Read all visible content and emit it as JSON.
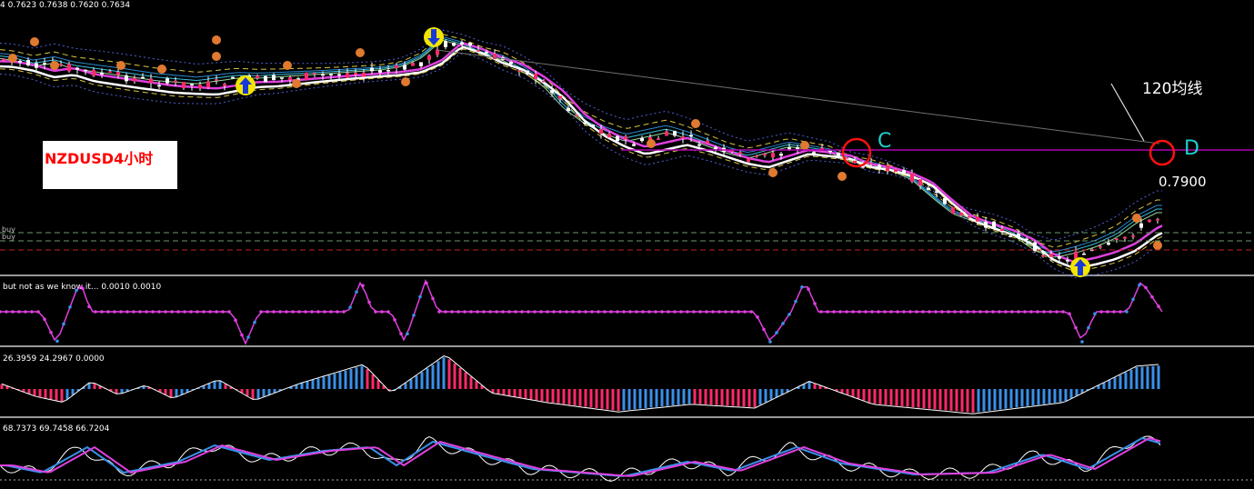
{
  "chart_data": [
    {
      "type": "candlestick",
      "panel": "price",
      "header_text": "4  0.7623 0.7638 0.7620 0.7634",
      "instrument_label": "NZDUSD4小时",
      "annotations": {
        "point_c": "C",
        "point_d": "D",
        "ma_label": "120均线",
        "price_level": "0.7900"
      },
      "buy_labels": [
        "buy",
        "buy"
      ],
      "trend_close": [
        0.795,
        0.7948,
        0.7944,
        0.7946,
        0.7942,
        0.794,
        0.7938,
        0.7936,
        0.7934,
        0.7933,
        0.7932,
        0.7934,
        0.7936,
        0.7936,
        0.7937,
        0.7938,
        0.7939,
        0.794,
        0.7941,
        0.7942,
        0.7944,
        0.795,
        0.7962,
        0.7958,
        0.7952,
        0.7948,
        0.794,
        0.793,
        0.7915,
        0.7905,
        0.7898,
        0.7893,
        0.7896,
        0.7899,
        0.7895,
        0.789,
        0.7885,
        0.7882,
        0.7886,
        0.789,
        0.7888,
        0.7886,
        0.788,
        0.7878,
        0.7874,
        0.7868,
        0.7856,
        0.7845,
        0.784,
        0.7836,
        0.783,
        0.782,
        0.7815,
        0.7818,
        0.7822,
        0.7828,
        0.7838,
        0.7845
      ]
    },
    {
      "type": "line",
      "panel": "indicator-1",
      "header_text": "but not as we know it...  0.0010 0.0010"
    },
    {
      "type": "histogram",
      "panel": "indicator-2",
      "header_text": "26.3959 24.2967 0.0000"
    },
    {
      "type": "line",
      "panel": "indicator-3",
      "header_text": "68.7373 69.7458 66.7204"
    }
  ]
}
